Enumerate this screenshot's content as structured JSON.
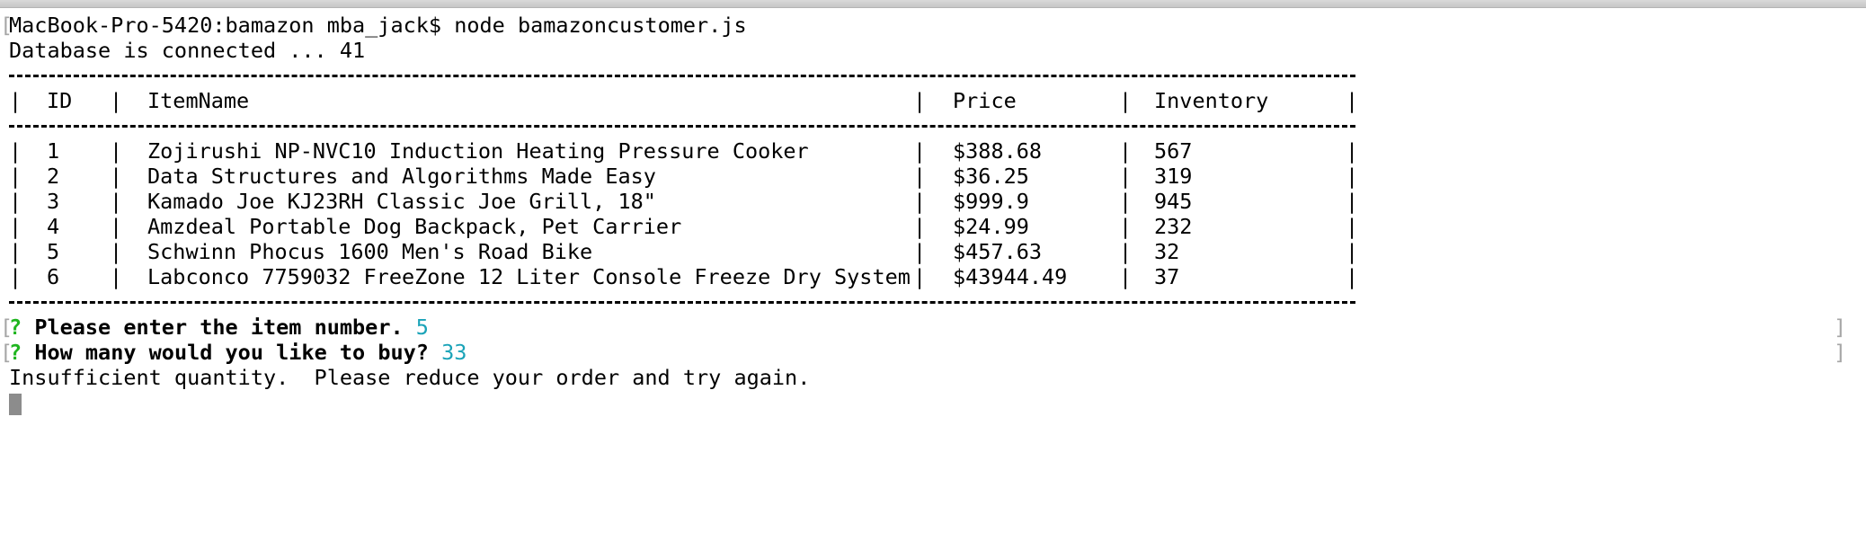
{
  "prompt": {
    "host": "MacBook-Pro-5420:bamazon mba_jack$",
    "command": "node bamazoncustomer.js"
  },
  "db_status": "Database is connected ... 41",
  "table": {
    "headers": {
      "id": "ID",
      "name": "ItemName",
      "price": "Price",
      "inventory": "Inventory"
    },
    "rows": [
      {
        "id": "1",
        "name": "Zojirushi NP-NVC10 Induction Heating Pressure Cooker",
        "price": "$388.68",
        "inventory": "567"
      },
      {
        "id": "2",
        "name": "Data Structures and Algorithms Made Easy",
        "price": "$36.25",
        "inventory": "319"
      },
      {
        "id": "3",
        "name": "Kamado Joe KJ23RH Classic Joe Grill, 18\"",
        "price": "$999.9",
        "inventory": "945"
      },
      {
        "id": "4",
        "name": "Amzdeal Portable Dog Backpack, Pet Carrier",
        "price": "$24.99",
        "inventory": "232"
      },
      {
        "id": "5",
        "name": "Schwinn Phocus 1600 Men's Road Bike",
        "price": "$457.63",
        "inventory": "32"
      },
      {
        "id": "6",
        "name": "Labconco 7759032 FreeZone 12 Liter Console Freeze Dry System",
        "price": "$43944.49",
        "inventory": "37"
      }
    ]
  },
  "questions": [
    {
      "mark": "?",
      "text": "Please enter the item number.",
      "answer": "5"
    },
    {
      "mark": "?",
      "text": "How many would you like to buy?",
      "answer": "33"
    }
  ],
  "result": "Insufficient quantity.  Please reduce your order and try again.",
  "colors": {
    "prompt_mark": "#1fb51f",
    "answer": "#1aa3b8",
    "cursor": "#8c8c8c"
  }
}
